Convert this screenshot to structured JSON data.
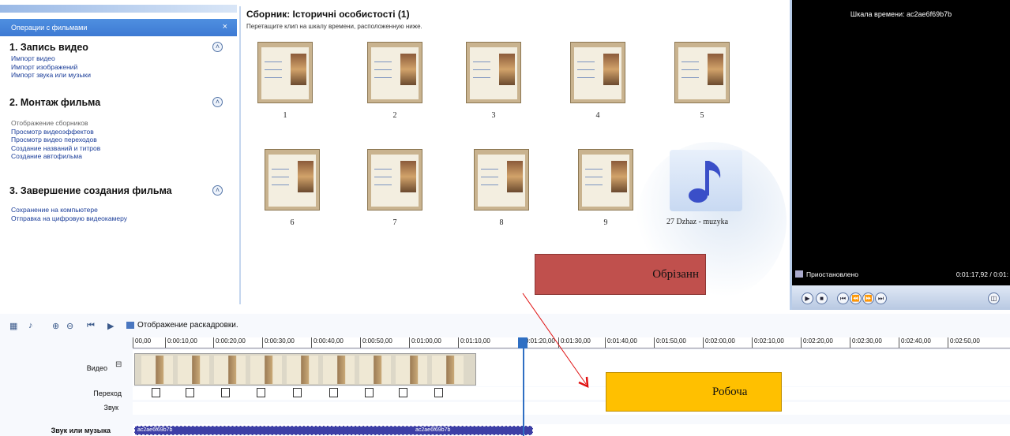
{
  "tasks": {
    "header": "Операции с фильмами",
    "close": "×",
    "sections": [
      {
        "title": "1. Запись видео",
        "links": [
          "Импорт видео",
          "Импорт изображений",
          "Импорт звука или музыки"
        ]
      },
      {
        "title": "2. Монтаж фильма",
        "links": [
          "Отображение сборников",
          "Просмотр видеоэффектов",
          "Просмотр видео переходов",
          "Создание названий и титров",
          "Создание автофильма"
        ]
      },
      {
        "title": "3. Завершение создания фильма",
        "links": [
          "Сохранение на компьютере",
          "Отправка на цифровую видеокамеру"
        ]
      }
    ]
  },
  "collection": {
    "title": "Сборник: Історичні особистості (1)",
    "hint": "Перетащите клип на шкалу времени, расположенную ниже.",
    "clips": [
      "1",
      "2",
      "3",
      "4",
      "5",
      "6",
      "7",
      "8",
      "9"
    ],
    "music": "27 Dzhaz - muzyka"
  },
  "preview": {
    "title": "Шкала времени: ac2ae6f69b7b",
    "status": "Приостановлено",
    "timecode": "0:01:17,92 / 0:01:"
  },
  "timeline": {
    "storyboard_label": "Отображение раскадровки.",
    "ruler": [
      "00,00",
      "0:00:10,00",
      "0:00:20,00",
      "0:00:30,00",
      "0:00:40,00",
      "0:00:50,00",
      "0:01:00,00",
      "0:01:10,00",
      "0:01:20,00",
      "0:01:30,00",
      "0:01:40,00",
      "0:01:50,00",
      "0:02:00,00",
      "0:02:10,00",
      "0:02:20,00",
      "0:02:30,00",
      "0:02:40,00",
      "0:02:50,00"
    ],
    "tracks": {
      "video": "Видео",
      "transition": "Переход",
      "audio": "Звук",
      "music": "Звук или музыка"
    },
    "audio_clip_a": "ac2ae6f69b7b",
    "audio_clip_b": "ac2ae6f69b7b"
  },
  "annotations": {
    "trim": "Обрізанн",
    "workspace": "Робоча"
  }
}
